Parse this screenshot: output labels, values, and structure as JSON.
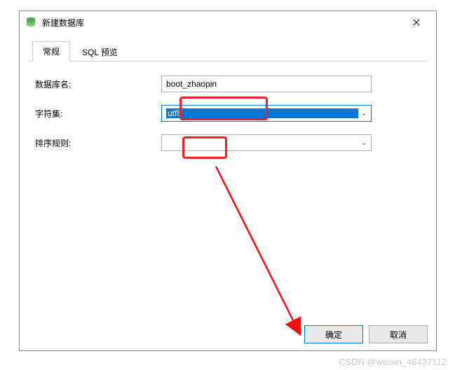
{
  "title": "新建数据库",
  "tabs": {
    "general": "常规",
    "sql_preview": "SQL 预览"
  },
  "form": {
    "db_name_label": "数据库名:",
    "db_name_value": "boot_zhaopin",
    "charset_label": "字符集:",
    "charset_value": "utf8",
    "collation_label": "排序规则:",
    "collation_value": ""
  },
  "buttons": {
    "ok": "确定",
    "cancel": "取消"
  },
  "watermark": "CSDN @weixin_46437112"
}
